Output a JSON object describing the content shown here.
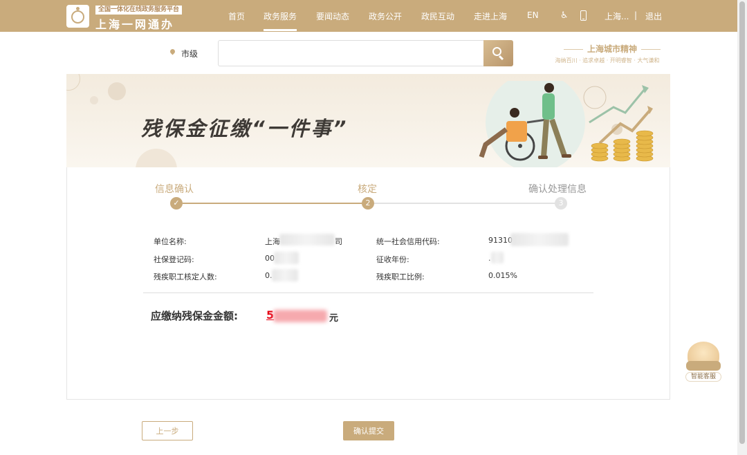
{
  "header": {
    "logo_tagline": "全国一体化在线政务服务平台",
    "logo_name": "上海一网通办",
    "nav": [
      {
        "label": "首页",
        "active": false
      },
      {
        "label": "政务服务",
        "active": true
      },
      {
        "label": "要闻动态",
        "active": false
      },
      {
        "label": "政务公开",
        "active": false
      },
      {
        "label": "政民互动",
        "active": false
      },
      {
        "label": "走进上海",
        "active": false
      }
    ],
    "lang": "EN",
    "user": "上海...",
    "separator": "|",
    "logout": "退出",
    "accent_color": "#c9ab7c"
  },
  "search": {
    "region": "市级",
    "placeholder": "",
    "button_icon": "search-icon"
  },
  "spirit": {
    "title": "上海城市精神",
    "subtitle": "海纳百川 · 追求卓越 · 开明睿智 · 大气谦和"
  },
  "banner": {
    "title": "残保金征缴“一件事”"
  },
  "steps": [
    {
      "label": "信息确认",
      "state": "done",
      "marker": "✓"
    },
    {
      "label": "核定",
      "state": "current",
      "marker": "2"
    },
    {
      "label": "确认处理信息",
      "state": "pending",
      "marker": "3"
    }
  ],
  "info": {
    "unit_name_label": "单位名称:",
    "unit_name_value": "上海",
    "unit_name_tail": "司",
    "credit_code_label": "统一社会信用代码:",
    "credit_code_value": "91310",
    "social_reg_label": "社保登记码:",
    "social_reg_value": "00",
    "year_label": "征收年份:",
    "year_value": ".",
    "disabled_count_label": "残疾职工核定人数:",
    "disabled_count_value": "0.",
    "disabled_ratio_label": "残疾职工比例:",
    "disabled_ratio_value": "0.015%"
  },
  "amount": {
    "label": "应缴纳残保金金额:",
    "value": "5",
    "unit": "元",
    "color": "#e60012"
  },
  "actions": {
    "prev": "上一步",
    "submit": "确认提交"
  },
  "assistant": {
    "label": "智能客服"
  }
}
